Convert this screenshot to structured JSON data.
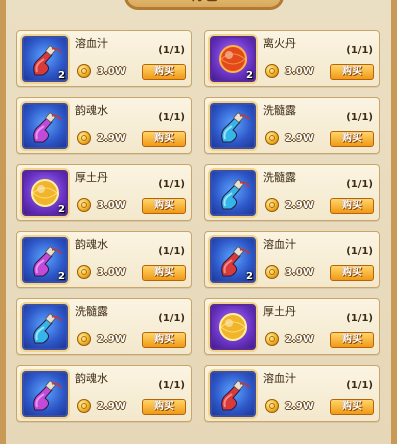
{
  "panel": {
    "title": "背包"
  },
  "items": [
    {
      "name": "溶血汁",
      "stock": "(1/1)",
      "price": "3.0W",
      "buy": "购买",
      "count": "2",
      "icon": "red-potion-icon",
      "frame": "blue"
    },
    {
      "name": "离火丹",
      "stock": "(1/1)",
      "price": "3.0W",
      "buy": "购买",
      "count": "2",
      "icon": "fire-pill-icon",
      "frame": "purple"
    },
    {
      "name": "韵魂水",
      "stock": "(1/1)",
      "price": "2.9W",
      "buy": "购买",
      "count": "",
      "icon": "pink-potion-icon",
      "frame": "blue"
    },
    {
      "name": "洗髓露",
      "stock": "(1/1)",
      "price": "2.9W",
      "buy": "购买",
      "count": "",
      "icon": "blue-potion-icon",
      "frame": "blue"
    },
    {
      "name": "厚土丹",
      "stock": "(1/1)",
      "price": "3.0W",
      "buy": "购买",
      "count": "2",
      "icon": "earth-pill-icon",
      "frame": "purple"
    },
    {
      "name": "洗髓露",
      "stock": "(1/1)",
      "price": "2.9W",
      "buy": "购买",
      "count": "",
      "icon": "blue-potion-icon",
      "frame": "blue"
    },
    {
      "name": "韵魂水",
      "stock": "(1/1)",
      "price": "3.0W",
      "buy": "购买",
      "count": "2",
      "icon": "pink-potion-icon",
      "frame": "blue"
    },
    {
      "name": "溶血汁",
      "stock": "(1/1)",
      "price": "3.0W",
      "buy": "购买",
      "count": "2",
      "icon": "red-potion-icon",
      "frame": "blue"
    },
    {
      "name": "洗髓露",
      "stock": "(1/1)",
      "price": "2.9W",
      "buy": "购买",
      "count": "",
      "icon": "blue-potion-icon",
      "frame": "blue"
    },
    {
      "name": "厚土丹",
      "stock": "(1/1)",
      "price": "2.9W",
      "buy": "购买",
      "count": "",
      "icon": "earth-pill-icon",
      "frame": "purple"
    },
    {
      "name": "韵魂水",
      "stock": "(1/1)",
      "price": "2.9W",
      "buy": "购买",
      "count": "",
      "icon": "pink-potion-icon",
      "frame": "blue"
    },
    {
      "name": "溶血汁",
      "stock": "(1/1)",
      "price": "2.9W",
      "buy": "购买",
      "count": "",
      "icon": "red-potion-icon",
      "frame": "blue"
    }
  ]
}
